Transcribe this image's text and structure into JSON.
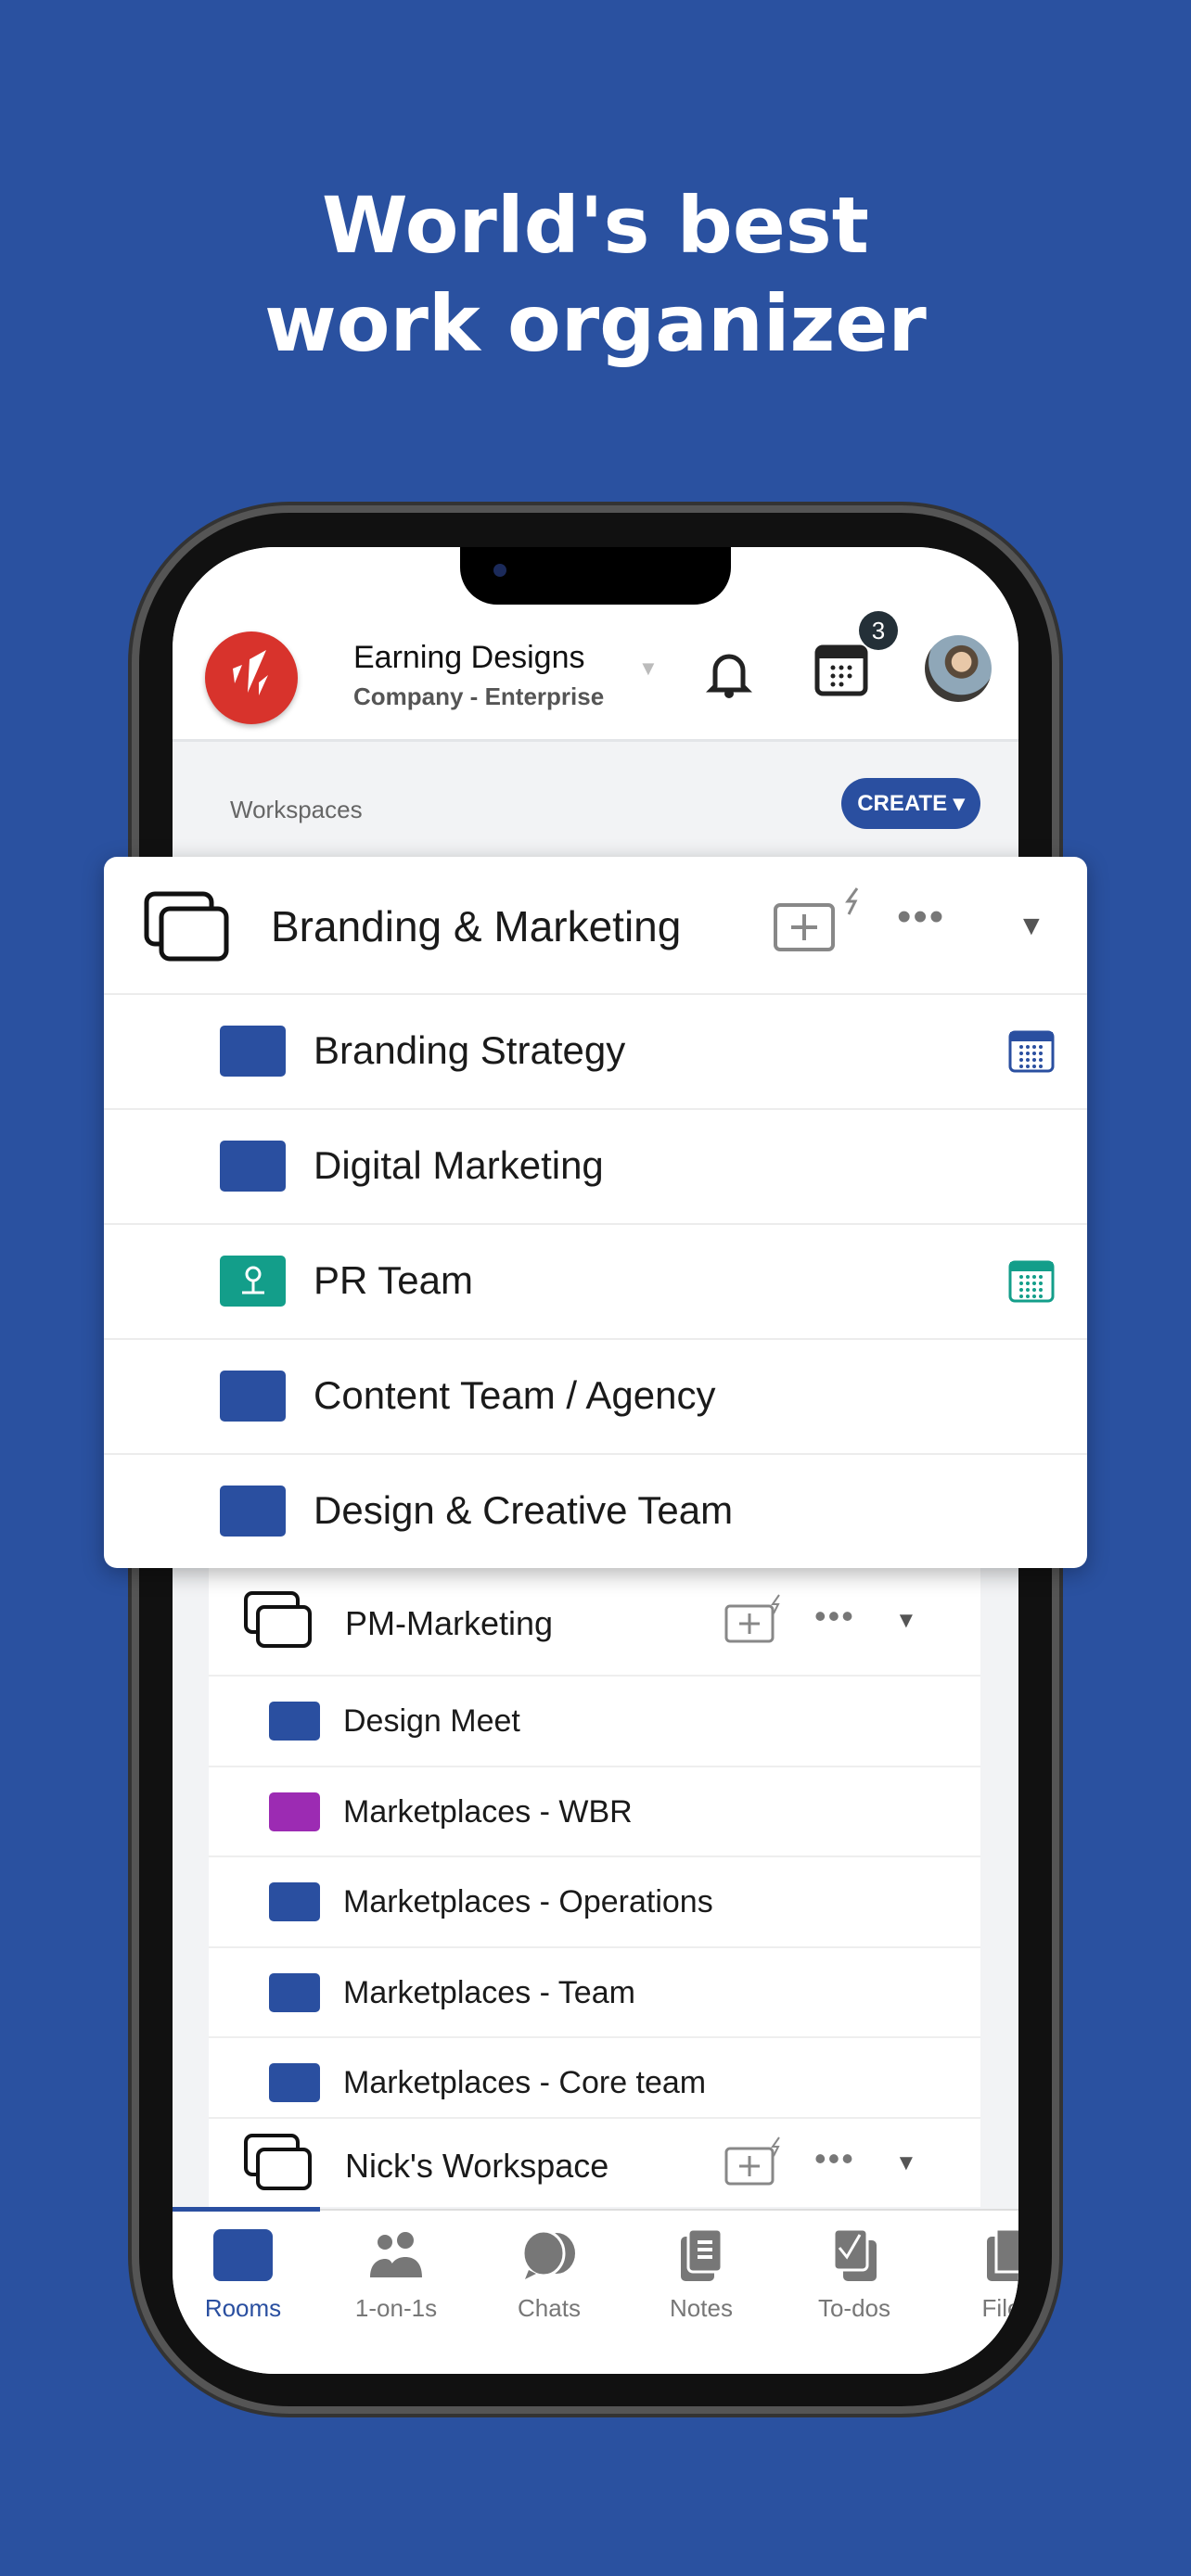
{
  "hero": {
    "line1": "World's best",
    "line2": "work organizer"
  },
  "header": {
    "company": "Earning Designs",
    "plan": "Company - Enterprise",
    "calendar_badge": "3"
  },
  "workspaces_label": "Workspaces",
  "create_button": "CREATE ▾",
  "expanded_workspace": {
    "title": "Branding & Marketing",
    "rooms": [
      {
        "label": "Branding Strategy",
        "color": "#2a4fa0",
        "calendar": true
      },
      {
        "label": "Digital Marketing",
        "color": "#2a4fa0",
        "calendar": false
      },
      {
        "label": "PR Team",
        "color": "#139e8a",
        "calendar": true,
        "icon": "map-pin-icon"
      },
      {
        "label": "Content Team / Agency",
        "color": "#2a4fa0",
        "calendar": false
      },
      {
        "label": "Design & Creative Team",
        "color": "#2a4fa0",
        "calendar": false
      }
    ]
  },
  "workspaces": [
    {
      "title": "PM-Marketing",
      "rooms": [
        {
          "label": "Design Meet",
          "color": "#2a4fa0"
        },
        {
          "label": "Marketplaces - WBR",
          "color": "#9c2bb3"
        },
        {
          "label": "Marketplaces - Operations",
          "color": "#2a4fa0"
        },
        {
          "label": "Marketplaces - Team",
          "color": "#2a4fa0"
        },
        {
          "label": "Marketplaces - Core team",
          "color": "#2a4fa0"
        }
      ]
    },
    {
      "title": "Nick's Workspace"
    }
  ],
  "nav": {
    "tabs": [
      {
        "label": "Rooms",
        "active": true
      },
      {
        "label": "1-on-1s"
      },
      {
        "label": "Chats"
      },
      {
        "label": "Notes"
      },
      {
        "label": "To-dos"
      },
      {
        "label": "Files"
      }
    ]
  },
  "colors": {
    "background": "#2a51a0",
    "accent": "#2a4fa0",
    "logo": "#d8332c"
  }
}
